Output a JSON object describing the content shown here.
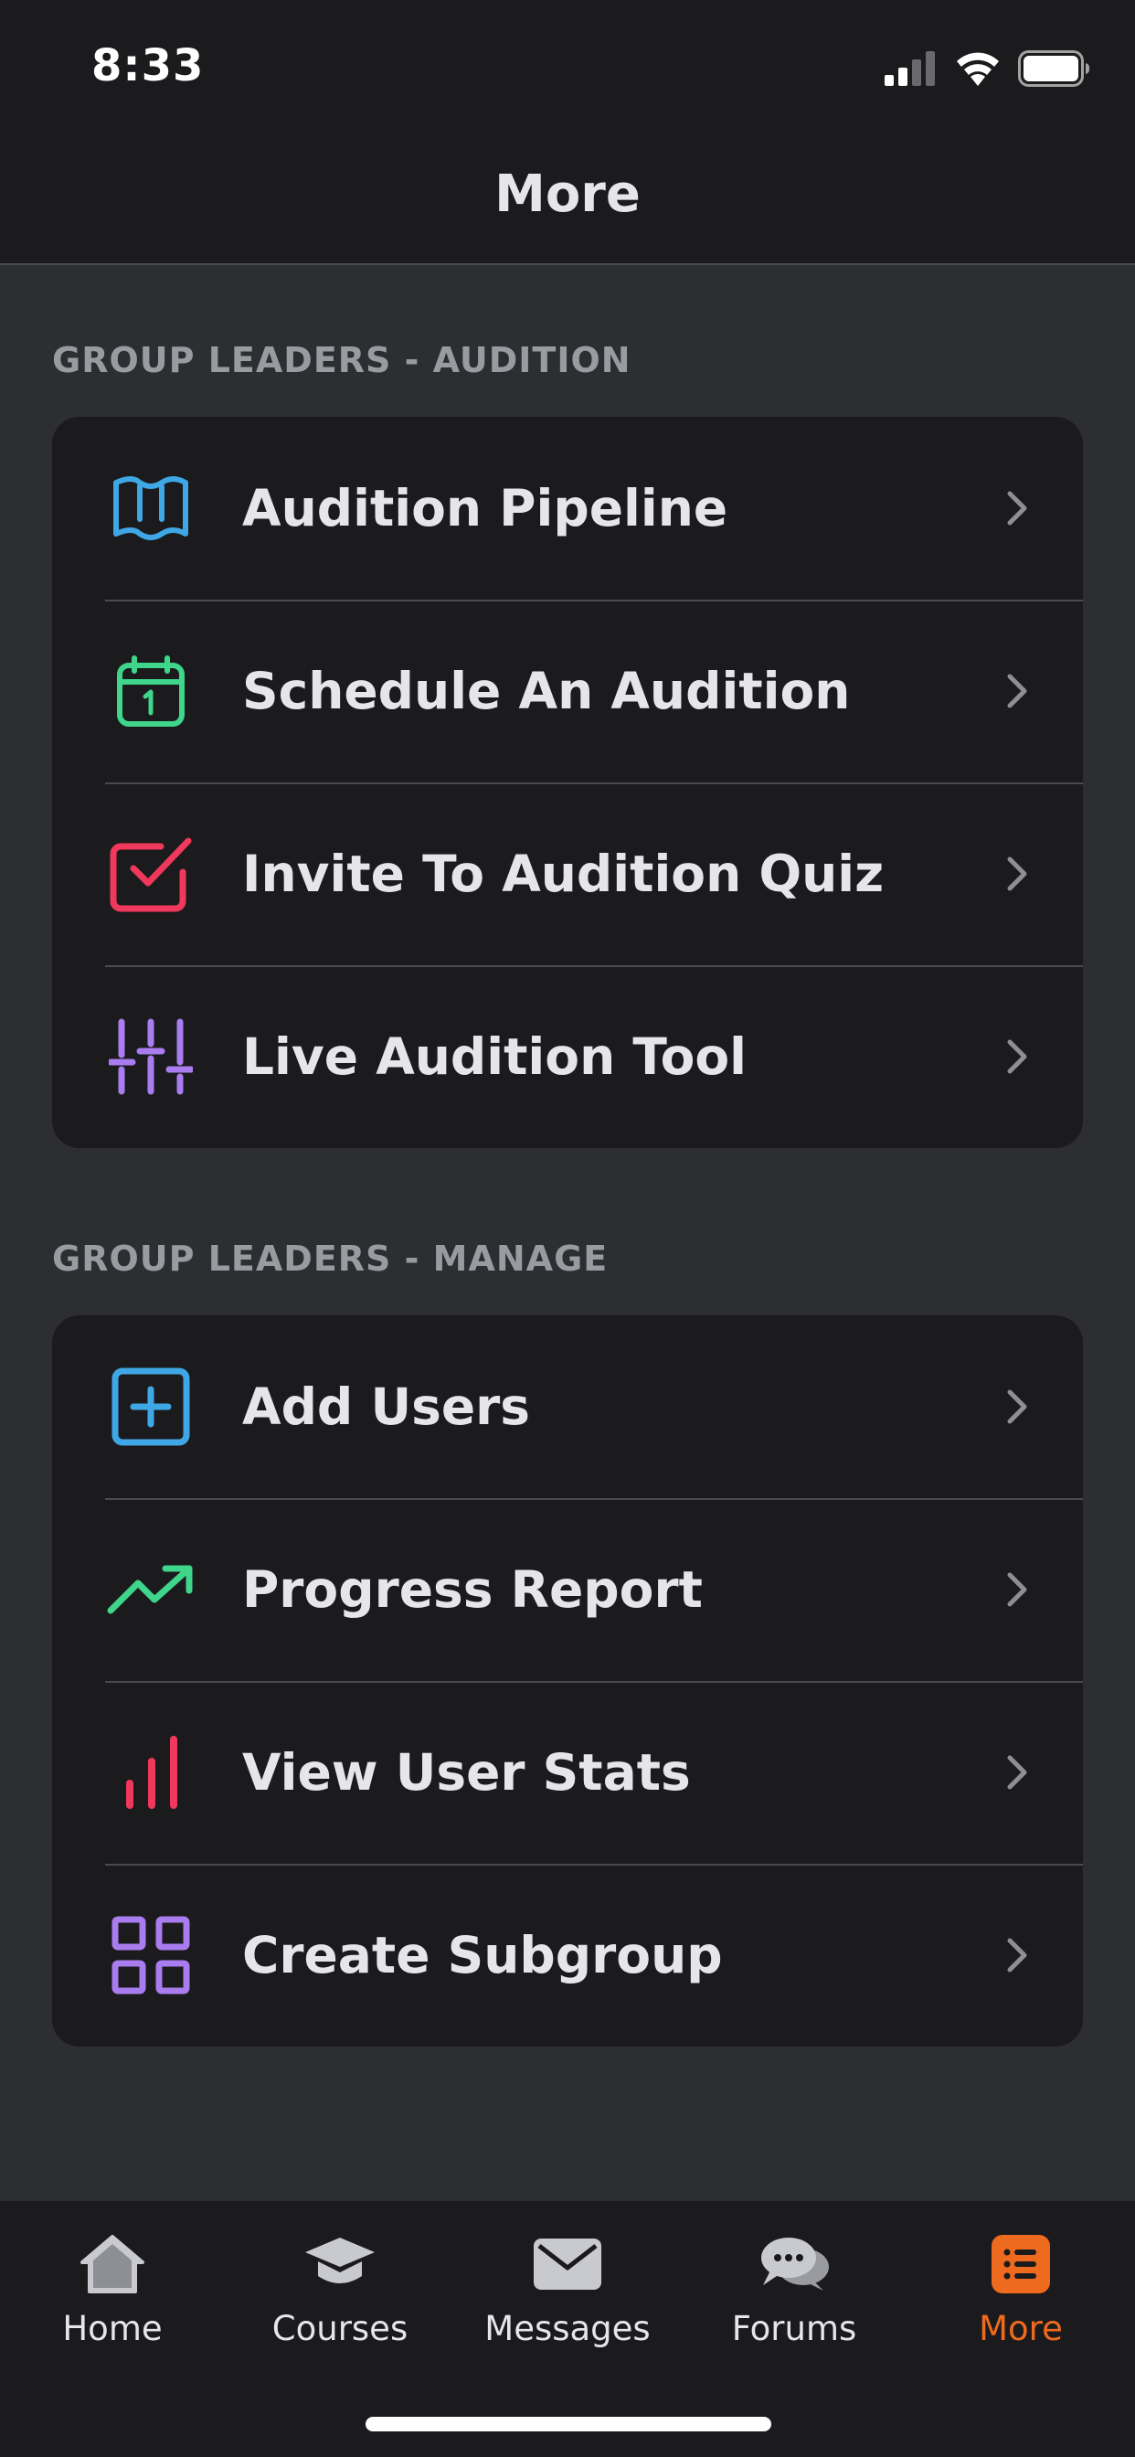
{
  "status": {
    "time": "8:33"
  },
  "header": {
    "title": "More"
  },
  "sections": [
    {
      "title": "GROUP LEADERS - AUDITION",
      "items": [
        {
          "label": "Audition Pipeline",
          "icon": "map-icon",
          "color": "#3fa7e6"
        },
        {
          "label": "Schedule An Audition",
          "icon": "calendar-icon",
          "color": "#3fd68b"
        },
        {
          "label": "Invite To Audition Quiz",
          "icon": "checkbox-icon",
          "color": "#f0385c"
        },
        {
          "label": "Live Audition Tool",
          "icon": "sliders-icon",
          "color": "#a97cf0"
        }
      ]
    },
    {
      "title": "GROUP LEADERS - MANAGE",
      "items": [
        {
          "label": "Add Users",
          "icon": "add-square-icon",
          "color": "#3fa7e6"
        },
        {
          "label": "Progress Report",
          "icon": "trending-up-icon",
          "color": "#3fd68b"
        },
        {
          "label": "View User Stats",
          "icon": "bar-chart-icon",
          "color": "#f0385c"
        },
        {
          "label": "Create Subgroup",
          "icon": "grid-icon",
          "color": "#a97cf0"
        }
      ]
    }
  ],
  "tabs": [
    {
      "label": "Home",
      "icon": "home-icon"
    },
    {
      "label": "Courses",
      "icon": "graduation-cap-icon"
    },
    {
      "label": "Messages",
      "icon": "envelope-icon"
    },
    {
      "label": "Forums",
      "icon": "chat-bubbles-icon"
    },
    {
      "label": "More",
      "icon": "list-icon",
      "active": true
    }
  ],
  "colors": {
    "accent": "#ee6a1e",
    "background": "#2d2e32",
    "surface": "#1b1b1d"
  }
}
